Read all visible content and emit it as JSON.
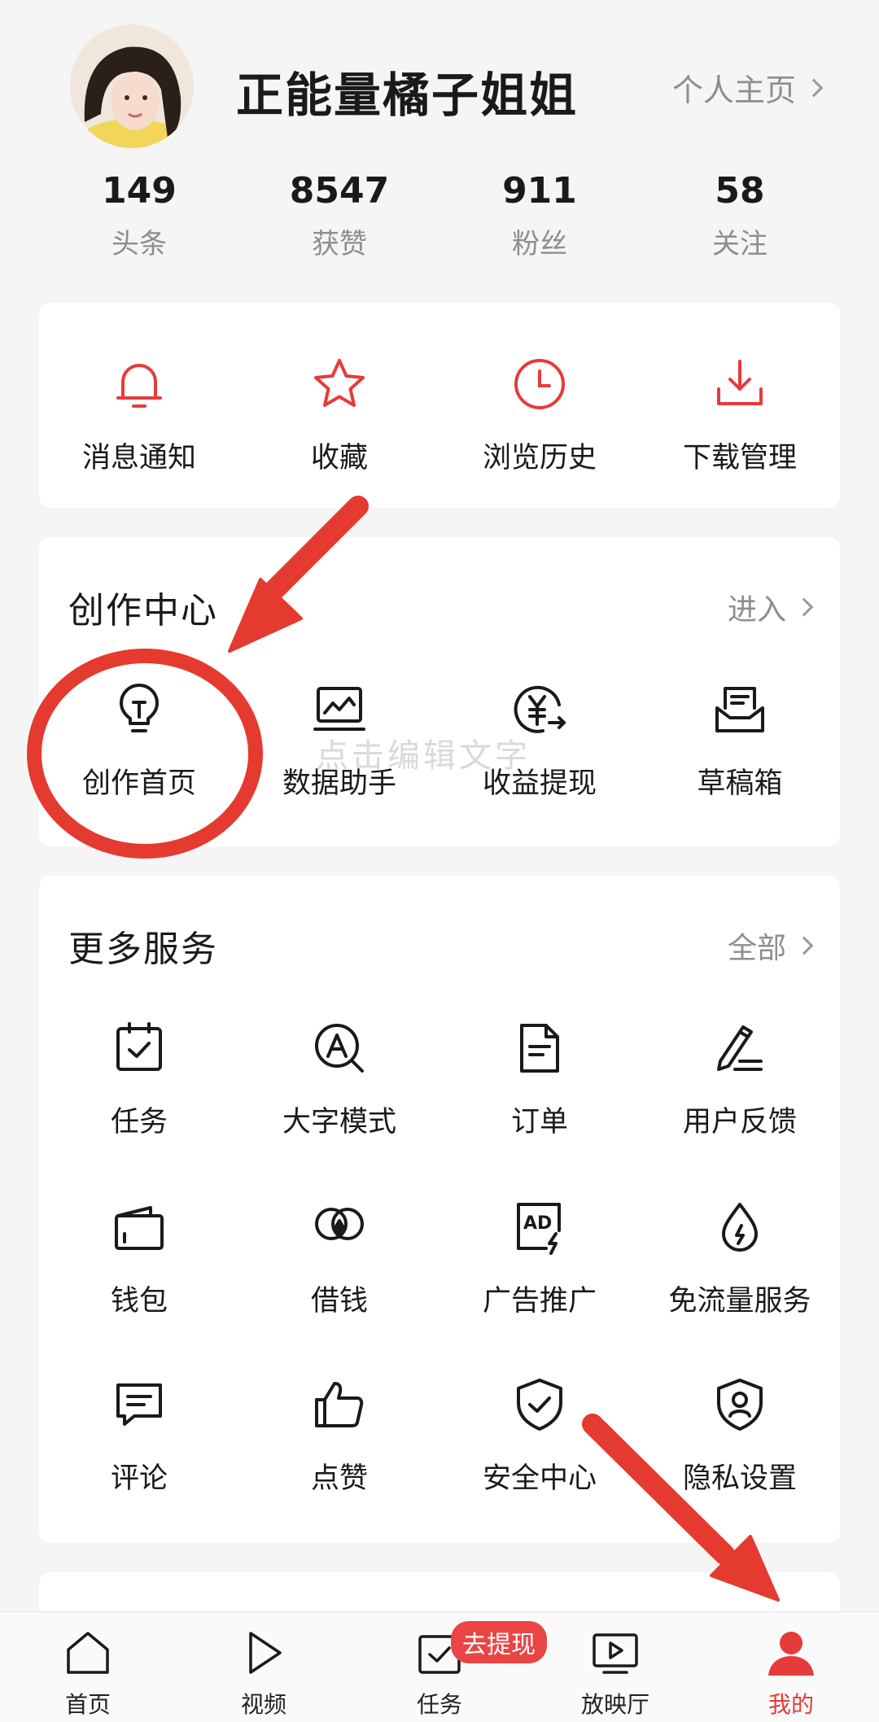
{
  "profile": {
    "username": "正能量橘子姐姐",
    "homepage_link": "个人主页"
  },
  "stats": [
    {
      "value": "149",
      "label": "头条"
    },
    {
      "value": "8547",
      "label": "获赞"
    },
    {
      "value": "911",
      "label": "粉丝"
    },
    {
      "value": "58",
      "label": "关注"
    }
  ],
  "quick_actions": [
    {
      "label": "消息通知",
      "icon": "bell-icon"
    },
    {
      "label": "收藏",
      "icon": "star-icon"
    },
    {
      "label": "浏览历史",
      "icon": "clock-icon"
    },
    {
      "label": "下载管理",
      "icon": "download-icon"
    }
  ],
  "creation_center": {
    "title": "创作中心",
    "more_label": "进入",
    "items": [
      {
        "label": "创作首页",
        "icon": "lightbulb-icon"
      },
      {
        "label": "数据助手",
        "icon": "chart-icon"
      },
      {
        "label": "收益提现",
        "icon": "yuan-coin-icon"
      },
      {
        "label": "草稿箱",
        "icon": "draft-box-icon"
      }
    ]
  },
  "watermark": "点击编辑文字",
  "more_services": {
    "title": "更多服务",
    "more_label": "全部",
    "items": [
      {
        "label": "任务",
        "icon": "calendar-check-icon"
      },
      {
        "label": "大字模式",
        "icon": "font-search-icon"
      },
      {
        "label": "订单",
        "icon": "document-icon"
      },
      {
        "label": "用户反馈",
        "icon": "pencil-icon"
      },
      {
        "label": "钱包",
        "icon": "wallet-icon"
      },
      {
        "label": "借钱",
        "icon": "loan-icon"
      },
      {
        "label": "广告推广",
        "icon": "ad-icon"
      },
      {
        "label": "免流量服务",
        "icon": "water-drop-icon"
      },
      {
        "label": "评论",
        "icon": "comment-icon"
      },
      {
        "label": "点赞",
        "icon": "thumbs-up-icon"
      },
      {
        "label": "安全中心",
        "icon": "shield-check-icon"
      },
      {
        "label": "隐私设置",
        "icon": "shield-user-icon"
      }
    ]
  },
  "bottom_nav": {
    "items": [
      {
        "label": "首页",
        "icon": "home-icon"
      },
      {
        "label": "视频",
        "icon": "play-icon"
      },
      {
        "label": "任务",
        "icon": "task-icon"
      },
      {
        "label": "放映厅",
        "icon": "tv-icon"
      },
      {
        "label": "我的",
        "icon": "user-icon"
      }
    ],
    "active_index": 4,
    "task_badge": "去提现"
  },
  "colors": {
    "accent": "#e63b3b",
    "annotation": "#e53a2f",
    "text_primary": "#1a1a1a",
    "text_secondary": "#8e8e8e"
  }
}
